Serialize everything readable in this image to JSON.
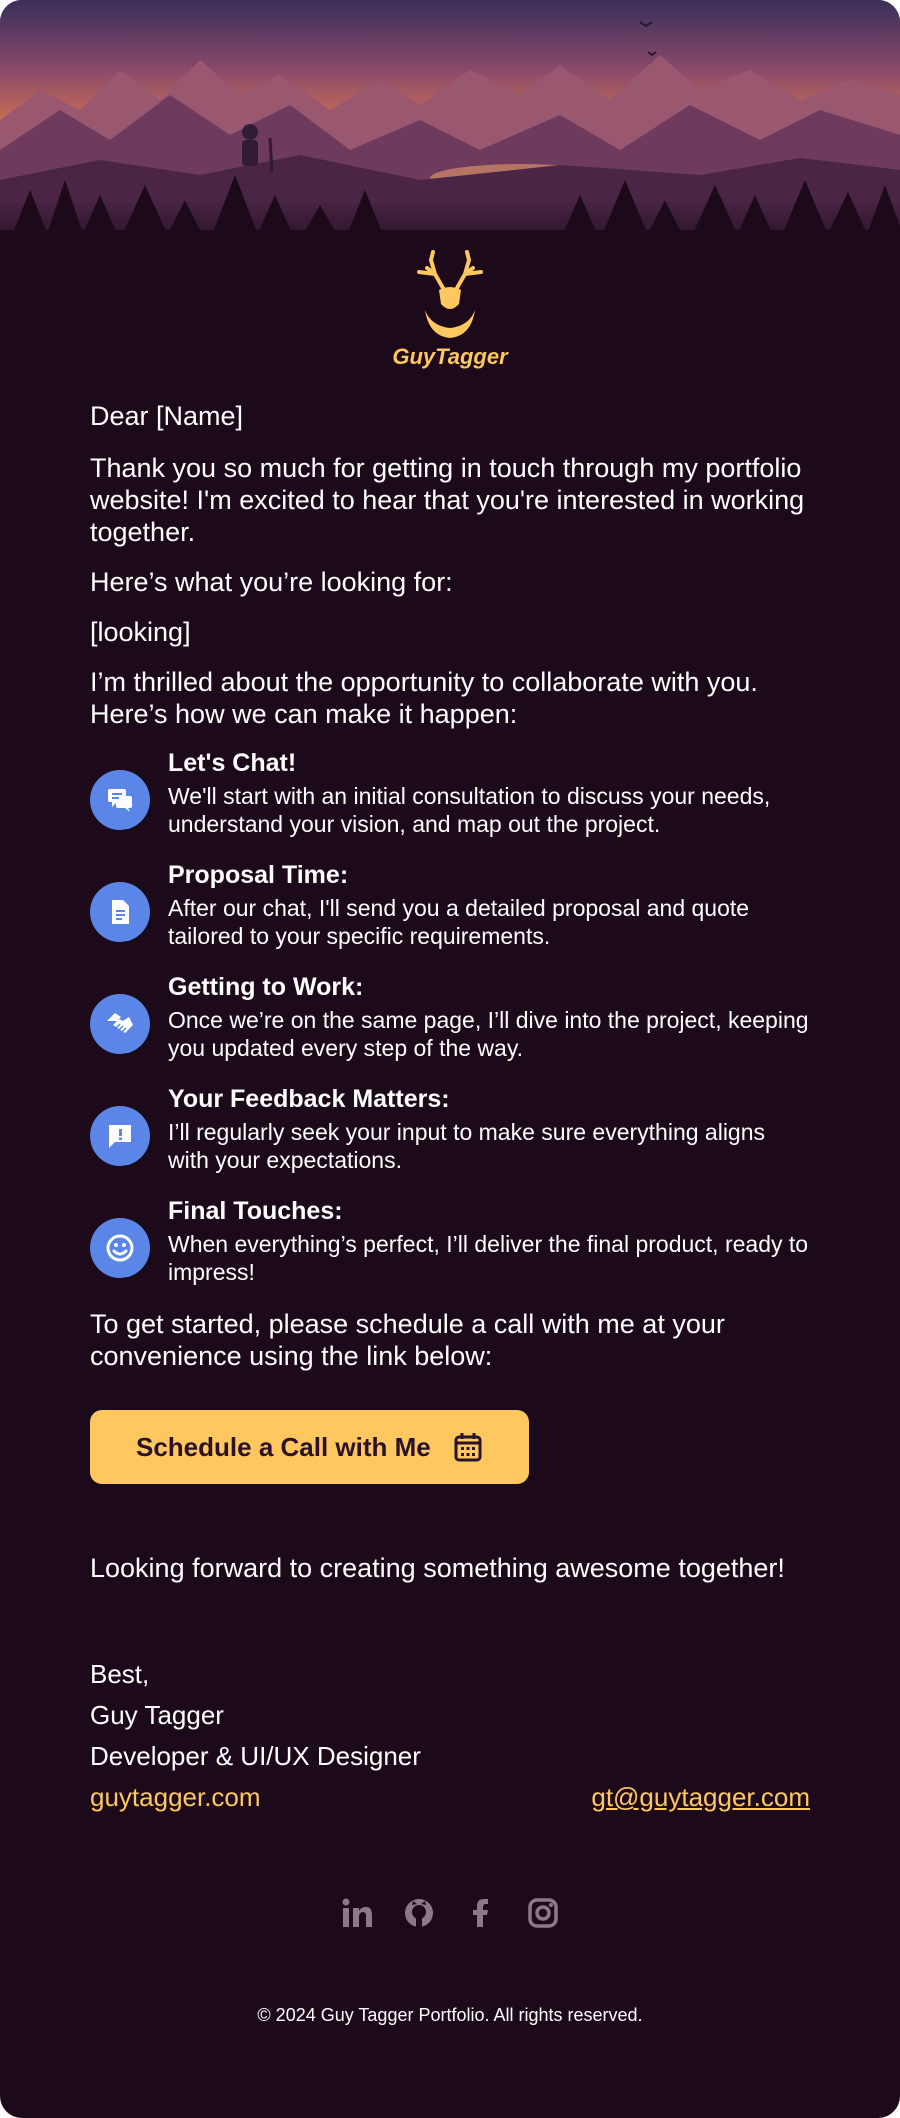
{
  "brand": {
    "name": "GuyTagger",
    "accent": "#ffc75f",
    "icon_color": "#5b86e8",
    "background": "#1c0a1a"
  },
  "letter": {
    "greeting": "Dear [Name]",
    "intro": "Thank you so much for getting in touch through my portfolio website! I'm excited to hear that you're interested in working together.",
    "looking_intro": "Here’s what you’re looking for:",
    "looking": "[looking]",
    "collab": "I’m thrilled about the opportunity to collaborate with you. Here’s how we can make it happen:",
    "steps": [
      {
        "icon": "chat-icon",
        "title": "Let's Chat!",
        "text": "We'll start with an initial consultation to discuss your needs, understand your vision, and map out the project."
      },
      {
        "icon": "document-icon",
        "title": "Proposal Time:",
        "text": "After our chat, I'll send you a detailed proposal and quote tailored to your specific requirements."
      },
      {
        "icon": "handshake-icon",
        "title": "Getting to Work:",
        "text": "Once we’re on the same page, I’ll dive into the project, keeping you updated every step of the way."
      },
      {
        "icon": "feedback-icon",
        "title": "Your Feedback Matters:",
        "text": "I’ll regularly seek your input to make sure everything aligns with your expectations."
      },
      {
        "icon": "smiley-icon",
        "title": "Final Touches:",
        "text": "When everything’s perfect, I’ll deliver the final product, ready to impress!"
      }
    ],
    "schedule_intro": "To get started, please schedule a call with me at your convenience using the link below:",
    "cta_label": "Schedule a Call with Me",
    "closing": "Looking forward to creating something awesome together!",
    "signoff": "Best,",
    "sender_name": "Guy Tagger",
    "sender_title": "Developer & UI/UX Designer",
    "website": "guytagger.com",
    "email": "gt@guytagger.com"
  },
  "social": [
    "linkedin-icon",
    "github-icon",
    "facebook-icon",
    "instagram-icon"
  ],
  "footer": {
    "copyright": "© 2024 Guy Tagger Portfolio. All rights reserved."
  }
}
